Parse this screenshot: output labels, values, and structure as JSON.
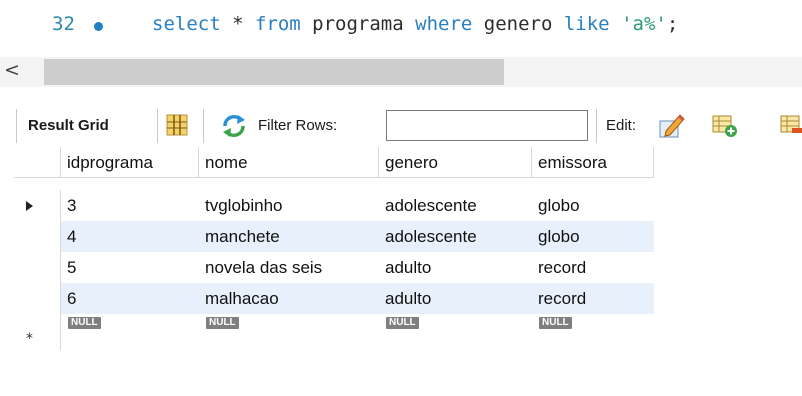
{
  "editor": {
    "line_number": "32",
    "sql_tokens": {
      "select": "select",
      "star": " * ",
      "from": "from",
      "table": " programa ",
      "where": "where",
      "col": " genero ",
      "like": "like",
      "space": " ",
      "pattern": "'a%'",
      "semi": ";"
    }
  },
  "hscroll": {
    "left_arrow": "<"
  },
  "toolbar": {
    "result_grid_label": "Result Grid",
    "filter_rows_label": "Filter Rows:",
    "filter_value": "",
    "edit_label": "Edit:"
  },
  "grid": {
    "columns": [
      "idprograma",
      "nome",
      "genero",
      "emissora"
    ],
    "rows": [
      [
        "3",
        "tvglobinho",
        "adolescente",
        "globo"
      ],
      [
        "4",
        "manchete",
        "adolescente",
        "globo"
      ],
      [
        "5",
        "novela das seis",
        "adulto",
        "record"
      ],
      [
        "6",
        "malhacao",
        "adulto",
        "record"
      ]
    ],
    "new_row_values": [
      "NULL",
      "NULL",
      "NULL",
      "NULL"
    ]
  },
  "colors": {
    "keyword": "#2a7fc1",
    "string": "#2e9b73",
    "alt_row": "#e8f0fb",
    "null_badge": "#7f7f7f"
  }
}
